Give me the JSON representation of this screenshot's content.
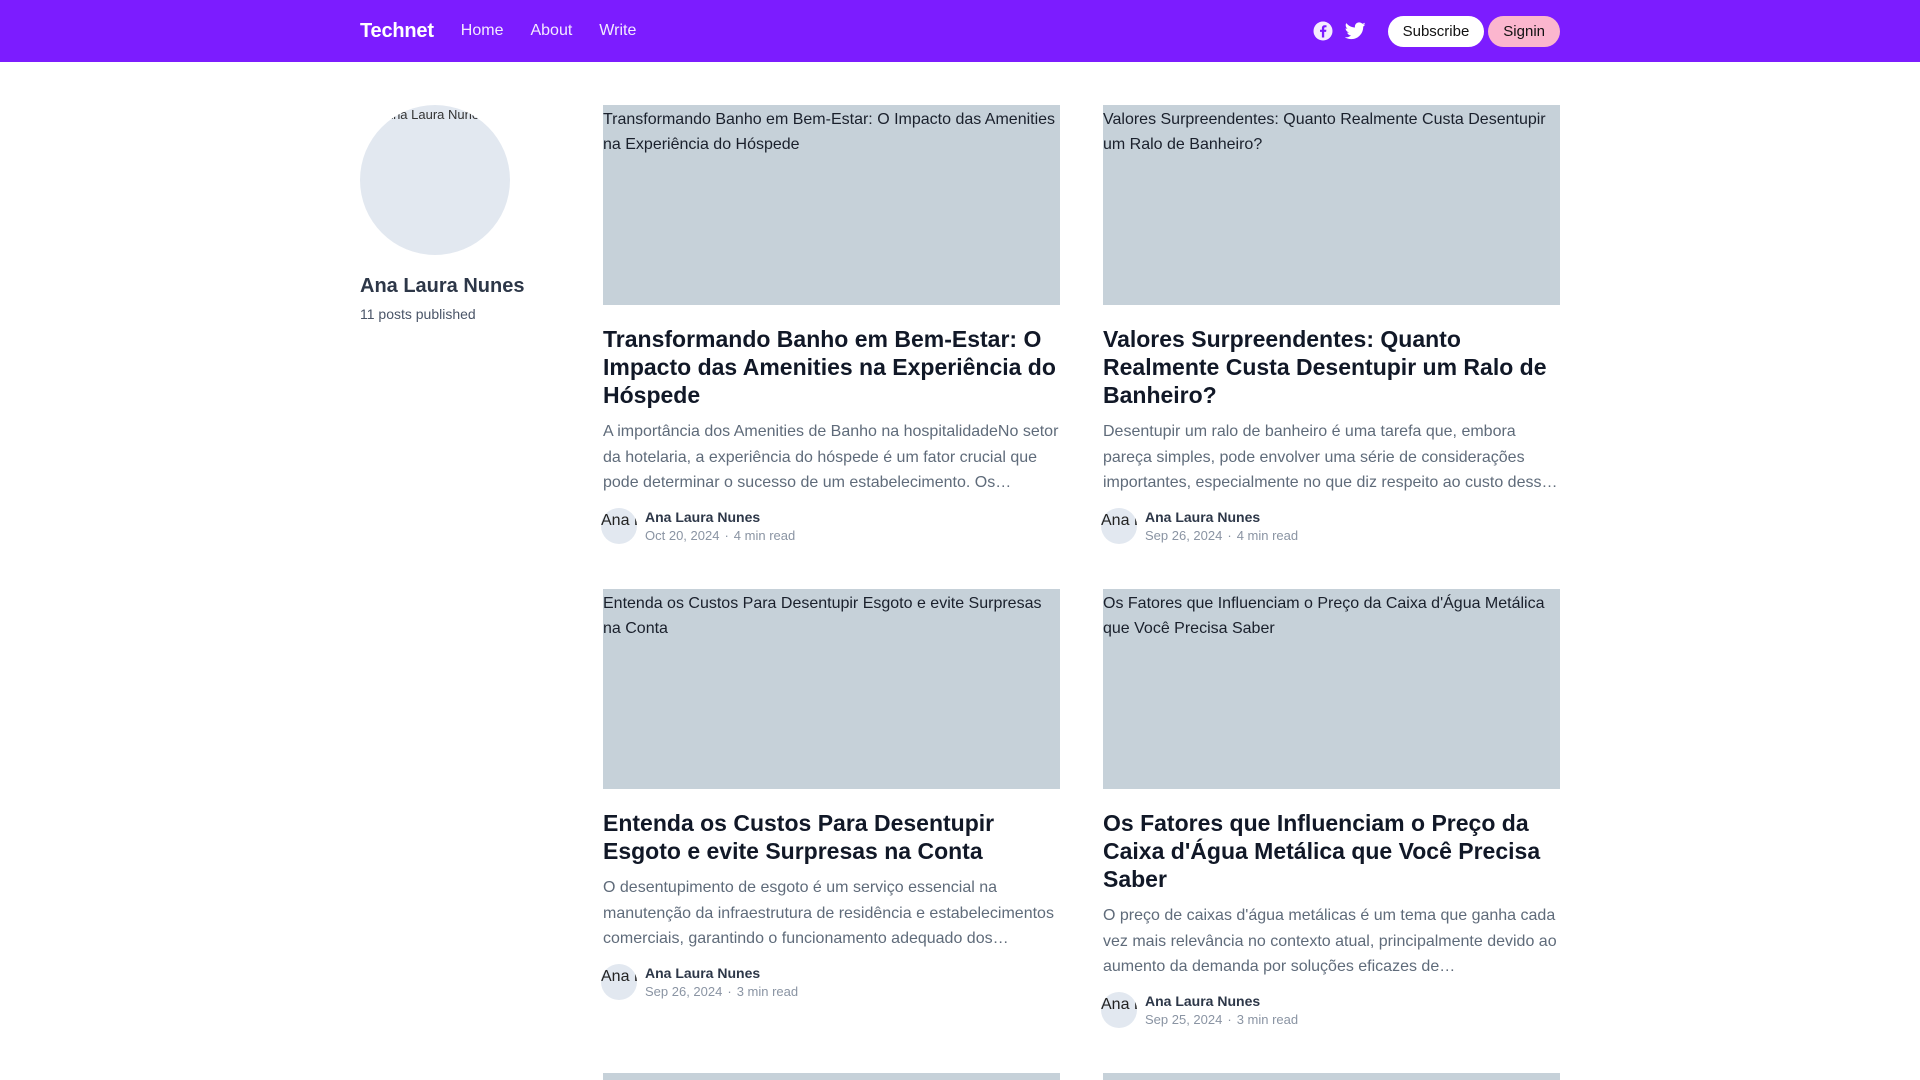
{
  "header": {
    "brand": "Technet",
    "nav": [
      "Home",
      "About",
      "Write"
    ],
    "subscribe_label": "Subscribe",
    "signin_label": "Signin",
    "colors": {
      "bar": "#7c1cff",
      "signin": "#fbb6ce"
    },
    "social_icons": [
      "facebook-icon",
      "twitter-icon"
    ]
  },
  "profile": {
    "avatar_alt": "Ana Laura Nunes",
    "name": "Ana Laura Nunes",
    "posts": "11 posts published"
  },
  "posts": [
    {
      "image_alt": "Transformando Banho em Bem-Estar: O Impacto das Amenities na Experiência do Hóspede",
      "title": "Transformando Banho em Bem-Estar: O Impacto das Amenities na Experiência do Hóspede",
      "excerpt": "A importância dos Amenities de Banho na hospitalidadeNo setor da hotelaria, a experiência do hóspede é um fator crucial que pode determinar o sucesso de um estabelecimento. Os amenities de banho desempenham um papel importante.",
      "author": "Ana Laura Nunes",
      "avatar_alt": "Ana Laura Nunes",
      "date": "Oct 20, 2024",
      "read": "4 min read"
    },
    {
      "image_alt": "Valores Surpreendentes: Quanto Realmente Custa Desentupir um Ralo de Banheiro?",
      "title": "Valores Surpreendentes: Quanto Realmente Custa Desentupir um Ralo de Banheiro?",
      "excerpt": "Desentupir um ralo de banheiro é uma tarefa que, embora pareça simples, pode envolver uma série de considerações importantes, especialmente no que diz respeito ao custo desse serviço.",
      "author": "Ana Laura Nunes",
      "avatar_alt": "Ana Laura Nunes",
      "date": "Sep 26, 2024",
      "read": "4 min read"
    },
    {
      "image_alt": "Entenda os Custos Para Desentupir Esgoto e evite Surpresas na Conta",
      "title": "Entenda os Custos Para Desentupir Esgoto e evite Surpresas na Conta",
      "excerpt": "O desentupimento de esgoto é um serviço essencial na manutenção da infraestrutura de residência e estabelecimentos comerciais, garantindo o funcionamento adequado dos sistemas.",
      "author": "Ana Laura Nunes",
      "avatar_alt": "Ana Laura Nunes",
      "date": "Sep 26, 2024",
      "read": "3 min read"
    },
    {
      "image_alt": "Os Fatores que Influenciam o Preço da Caixa d'Água Metálica que Você Precisa Saber",
      "title": "Os Fatores que Influenciam o Preço da Caixa d'Água Metálica que Você Precisa Saber",
      "excerpt": "O preço de caixas d'água metálicas é um tema que ganha cada vez mais relevância no contexto atual, principalmente devido ao aumento da demanda por soluções eficazes de armazenamento.",
      "author": "Ana Laura Nunes",
      "avatar_alt": "Ana Laura Nunes",
      "date": "Sep 25, 2024",
      "read": "3 min read"
    }
  ]
}
